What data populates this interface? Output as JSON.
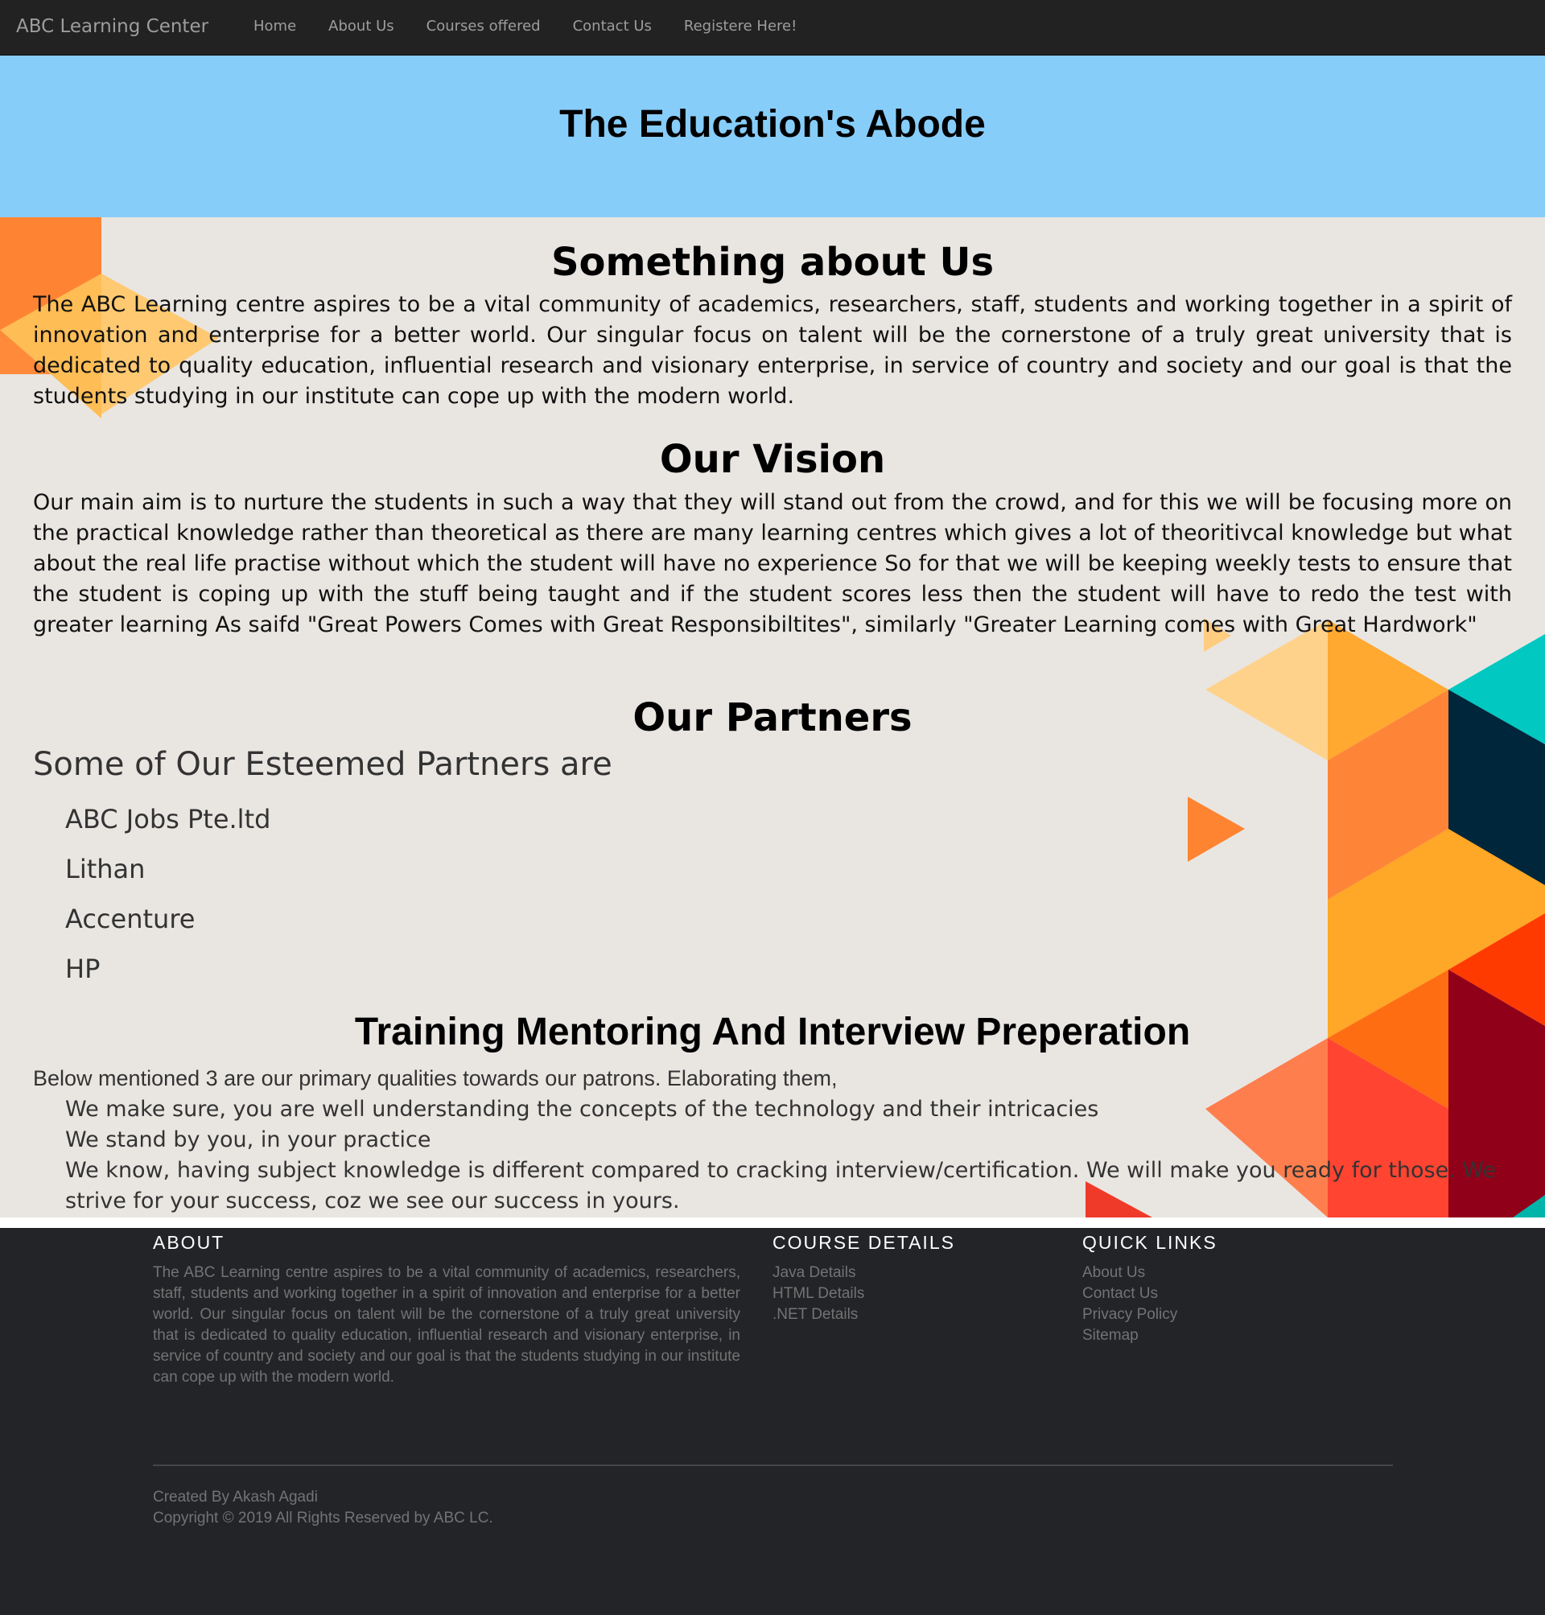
{
  "navbar": {
    "brand": "ABC Learning Center",
    "items": [
      {
        "label": "Home"
      },
      {
        "label": "About Us"
      },
      {
        "label": "Courses offered"
      },
      {
        "label": "Contact Us"
      },
      {
        "label": "Registere Here!"
      }
    ]
  },
  "hero": {
    "title": "The Education's Abode"
  },
  "about": {
    "title": "Something about Us",
    "text": "The ABC Learning centre aspires to be a vital community of academics, researchers, staff, students and working together in a spirit of innovation and enterprise for a better world. Our singular focus on talent will be the cornerstone of a truly great university that is dedicated to quality education, influential research and visionary enterprise, in service of country and society and our goal is that the students studying in our institute can cope up with the modern world."
  },
  "vision": {
    "title": "Our Vision",
    "text": "Our main aim is to nurture the students in such a way that they will stand out from the crowd, and for this we will be focusing more on the practical knowledge rather than theoretical as there are many learning centres which gives a lot of theoritivcal knowledge but what about the real life practise without which the student will have no experience So for that we will be keeping weekly tests to ensure that the student is coping up with the stuff being taught and if the student scores less then the student will have to redo the test with greater learning As saifd \"Great Powers Comes with Great Responsibiltites\", similarly \"Greater Learning comes with Great Hardwork\""
  },
  "partners": {
    "title": "Our Partners",
    "intro": "Some of Our Esteemed Partners are",
    "list": [
      "ABC Jobs Pte.ltd",
      "Lithan",
      "Accenture",
      "HP"
    ]
  },
  "training": {
    "title": "Training Mentoring And Interview Preperation",
    "intro": "Below mentioned 3 are our primary qualities towards our patrons. Elaborating them,",
    "qualities": [
      "We make sure, you are well understanding the concepts of the technology and their intricacies",
      "We stand by you, in your practice",
      "We know, having subject knowledge is different compared to cracking interview/certification. We will make you ready for those. We strive for your success, coz we see our success in yours."
    ]
  },
  "footer": {
    "about_title": "ABOUT",
    "about_text": "The ABC Learning centre aspires to be a vital community of academics, researchers, staff, students and working together in a spirit of innovation and enterprise for a better world. Our singular focus on talent will be the cornerstone of a truly great university that is dedicated to quality education, influential research and visionary enterprise, in service of country and society and our goal is that the students studying in our institute can cope up with the modern world.",
    "course_title": "COURSE DETAILS",
    "course_links": [
      "Java Details",
      "HTML Details",
      ".NET Details"
    ],
    "quick_title": "QUICK LINKS",
    "quick_links": [
      "About Us",
      "Contact Us",
      "Privacy Policy",
      "Sitemap"
    ],
    "created": "Created By Akash Agadi",
    "copyright": "Copyright © 2019 All Rights Reserved by ABC LC."
  },
  "colors": {
    "navbar_bg": "#222222",
    "nav_text": "#9d9d9d",
    "hero_bg": "#87cdfa",
    "page_bg": "#e9e6e2",
    "footer_bg": "#232428",
    "footer_text": "#737373"
  }
}
